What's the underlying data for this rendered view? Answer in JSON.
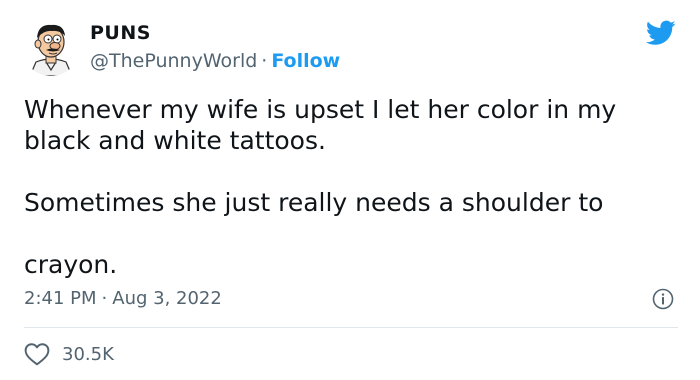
{
  "author": {
    "display_name": "PUNS",
    "handle": "@ThePunnyWorld",
    "separator": "·",
    "follow_label": "Follow"
  },
  "tweet": {
    "paragraphs": [
      "Whenever my wife is upset I let her color in my black and white tattoos.",
      "Sometimes she just really needs a shoulder to",
      "crayon."
    ]
  },
  "meta": {
    "time": "2:41 PM",
    "separator": "·",
    "date": "Aug 3, 2022"
  },
  "engagement": {
    "likes": "30.5K"
  },
  "icons": {
    "brand": "twitter-bird-icon",
    "info": "info-icon",
    "like": "heart-icon"
  },
  "colors": {
    "accent": "#1d9bf0",
    "text": "#0f1419",
    "secondary": "#536471",
    "divider": "#e1e8ed"
  }
}
